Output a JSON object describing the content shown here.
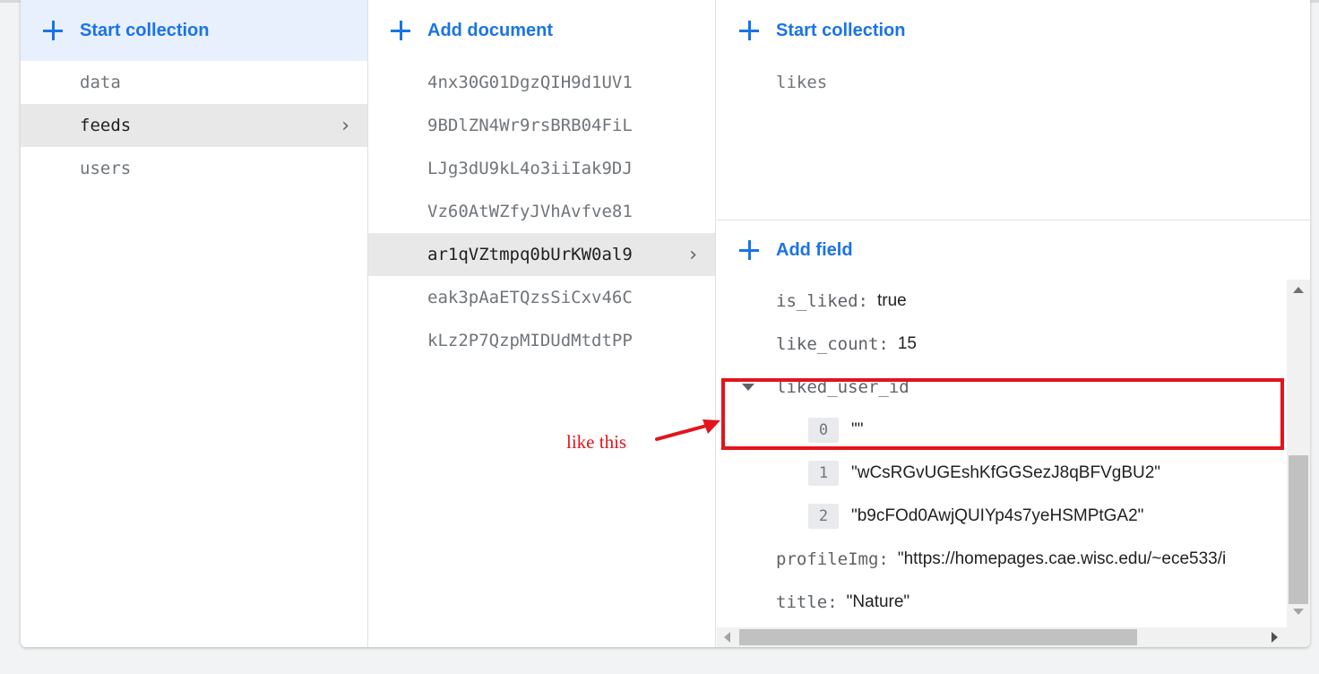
{
  "collections": {
    "action_label": "Start collection",
    "items": [
      {
        "name": "data",
        "selected": false
      },
      {
        "name": "feeds",
        "selected": true
      },
      {
        "name": "users",
        "selected": false
      }
    ]
  },
  "documents": {
    "action_label": "Add document",
    "items": [
      {
        "id": "4nx30G01DgzQIH9d1UV1",
        "selected": false
      },
      {
        "id": "9BDlZN4Wr9rsBRB04FiL",
        "selected": false
      },
      {
        "id": "LJg3dU9kL4o3iiIak9DJ",
        "selected": false
      },
      {
        "id": "Vz60AtWZfyJVhAvfve81",
        "selected": false
      },
      {
        "id": "ar1qVZtmpq0bUrKW0al9",
        "selected": true
      },
      {
        "id": "eak3pAaETQzsSiCxv46C",
        "selected": false
      },
      {
        "id": "kLz2P7QzpMIDUdMtdtPP",
        "selected": false
      }
    ]
  },
  "document_detail": {
    "subcollection_action_label": "Start collection",
    "subcollections": [
      "likes"
    ],
    "field_action_label": "Add field",
    "fields": {
      "is_liked": {
        "key": "is_liked",
        "value": "true"
      },
      "like_count": {
        "key": "like_count",
        "value": "15"
      },
      "liked_user_id": {
        "key": "liked_user_id",
        "items": [
          {
            "index": "0",
            "value": "\"\""
          },
          {
            "index": "1",
            "value": "\"wCsRGvUGEshKfGGSezJ8qBFVgBU2\""
          },
          {
            "index": "2",
            "value": "\"b9cFOd0AwjQUIYp4s7yeHSMPtGA2\""
          }
        ]
      },
      "profileImg": {
        "key": "profileImg",
        "value": "\"https://homepages.cae.wisc.edu/~ece533/i"
      },
      "title": {
        "key": "title",
        "value": "\"Nature\""
      }
    }
  },
  "annotation": {
    "text": "like this",
    "color": "#e3141b"
  },
  "colors": {
    "accent": "#1a73e8",
    "selected_bg": "#e8e8e8",
    "highlight_bg": "#e8f0fe"
  }
}
